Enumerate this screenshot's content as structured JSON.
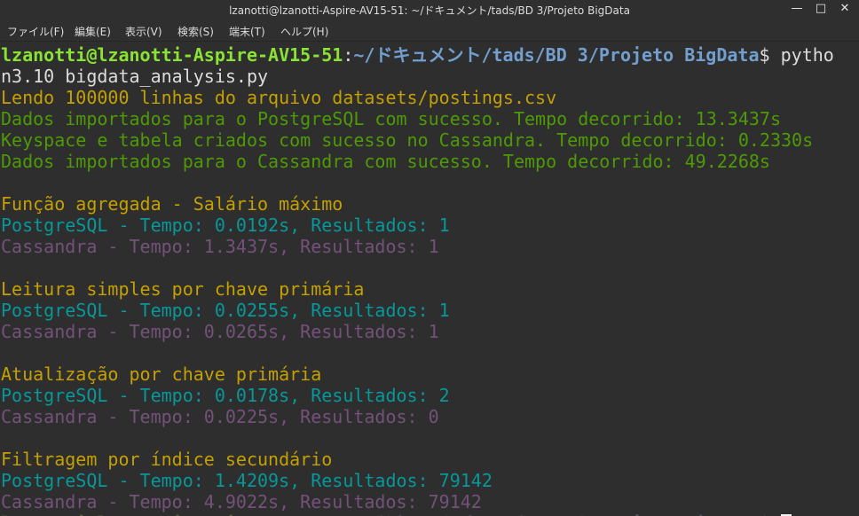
{
  "window": {
    "title": "lzanotti@lzanotti-Aspire-AV15-51: ~/ドキュメント/tads/BD 3/Projeto BigData",
    "controls": [
      "minimize-icon",
      "maximize-icon",
      "close-icon"
    ]
  },
  "menu": {
    "file": "ファイル(F)",
    "edit": "編集(E)",
    "view": "表示(V)",
    "search": "検索(S)",
    "terminal": "端末(T)",
    "help": "ヘルプ(H)"
  },
  "terminal": {
    "prompt_user": "lzanotti@lzanotti-Aspire-AV15-51",
    "prompt_colon": ":",
    "prompt_path": "~/ドキュメント/tads/BD 3/Projeto BigData",
    "prompt_dollar": "$ ",
    "command_part1": "pytho",
    "command_part2": "n3.10 bigdata_analysis.py",
    "output": {
      "l1": "Lendo 100000 linhas do arquivo datasets/postings.csv",
      "l2": "Dados importados para o PostgreSQL com sucesso. Tempo decorrido: 13.3437s",
      "l3": "Keyspace e tabela criados com sucesso no Cassandra. Tempo decorrido: 0.2330s",
      "l4": "Dados importados para o Cassandra com sucesso. Tempo decorrido: 49.2268s",
      "s1_title": "Função agregada - Salário máximo",
      "s1_pg": "PostgreSQL - Tempo: 0.0192s, Resultados: 1",
      "s1_cs": "Cassandra - Tempo: 1.3437s, Resultados: 1",
      "s2_title": "Leitura simples por chave primária",
      "s2_pg": "PostgreSQL - Tempo: 0.0255s, Resultados: 1",
      "s2_cs": "Cassandra - Tempo: 0.0265s, Resultados: 1",
      "s3_title": "Atualização por chave primária",
      "s3_pg": "PostgreSQL - Tempo: 0.0178s, Resultados: 2",
      "s3_cs": "Cassandra - Tempo: 0.0225s, Resultados: 0",
      "s4_title": "Filtragem por índice secundário",
      "s4_pg": "PostgreSQL - Tempo: 1.4209s, Resultados: 79142",
      "s4_cs": "Cassandra - Tempo: 4.9022s, Resultados: 79142"
    }
  },
  "colors": {
    "background": "#2e2e2e",
    "prompt_user": "#8ae234",
    "prompt_path": "#729fcf",
    "yellow": "#c4a000",
    "green": "#4e9a06",
    "cyan": "#06989a",
    "purple": "#75507b"
  }
}
